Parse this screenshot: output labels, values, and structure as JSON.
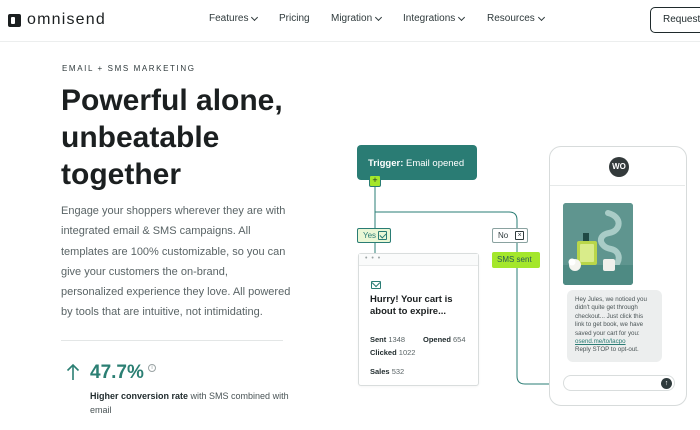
{
  "nav": {
    "logo_text": "omnisend",
    "items": [
      {
        "label": "Features",
        "dropdown": true
      },
      {
        "label": "Pricing",
        "dropdown": false
      },
      {
        "label": "Migration",
        "dropdown": true
      },
      {
        "label": "Integrations",
        "dropdown": true
      },
      {
        "label": "Resources",
        "dropdown": true
      }
    ],
    "request_button": "Request d"
  },
  "hero": {
    "kicker": "EMAIL + SMS MARKETING",
    "headline_lines": [
      "Powerful alone,",
      "unbeatable",
      "together"
    ],
    "description": "Engage your shoppers wherever they are with integrated email & SMS campaigns. All templates are 100% customizable, so you can give your customers the on-brand, personalized experience they love. All powered by tools that are intuitive, not intimidating."
  },
  "stat": {
    "value": "47.7%",
    "caption_bold": "Higher conversion rate",
    "caption_rest": " with SMS combined with email"
  },
  "flow": {
    "trigger_label": "Trigger:",
    "trigger_value": "Email opened",
    "plus": "+",
    "yes_label": "Yes",
    "no_label": "No",
    "sms_sent": "SMS sent",
    "email_card": {
      "dots": "• • •",
      "title": "Hurry! Your cart is about to expire...",
      "sent_label": "Sent",
      "sent_value": "1348",
      "opened_label": "Opened",
      "opened_value": "654",
      "clicked_label": "Clicked",
      "clicked_value": "1022",
      "sales_label": "Sales",
      "sales_value": "532"
    }
  },
  "phone": {
    "avatar": "WO",
    "sms_text": "Hey Jules, we noticed you didn't quite get through checkout... Just click this link to get book, we have saved your cart for you:",
    "sms_link": "osend.me/to/lacpo",
    "sms_footer": "Reply STOP to opt-out."
  },
  "colors": {
    "teal": "#2a7c74",
    "lime": "#a4e72b",
    "stat_green": "#2b7f73"
  }
}
